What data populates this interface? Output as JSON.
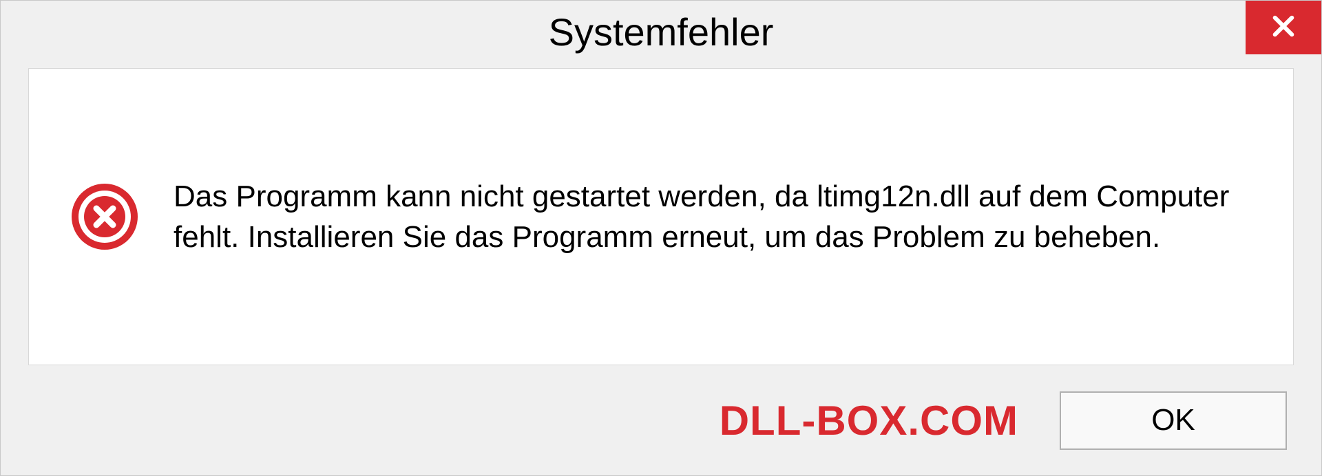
{
  "dialog": {
    "title": "Systemfehler",
    "message": "Das Programm kann nicht gestartet werden, da ltimg12n.dll auf dem Computer fehlt. Installieren Sie das Programm erneut, um das Problem zu beheben.",
    "ok_label": "OK"
  },
  "watermark": "DLL-BOX.COM",
  "colors": {
    "error_red": "#d9292f",
    "dialog_bg": "#f0f0f0",
    "border": "#c8c8c8"
  }
}
